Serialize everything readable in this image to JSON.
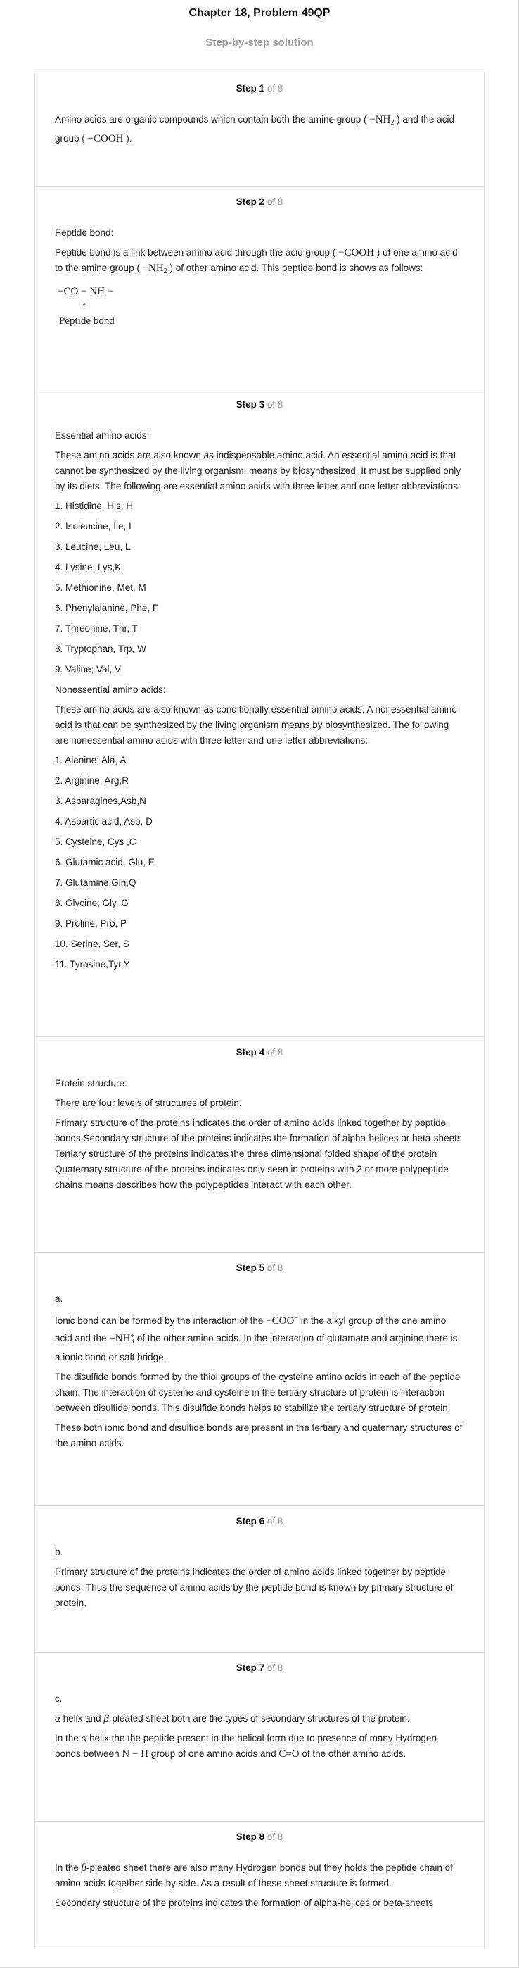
{
  "header": {
    "title": "Chapter 18, Problem 49QP",
    "subtitle": "Step-by-step solution"
  },
  "of_total": "of 8",
  "steps": [
    {
      "label": "Step 1",
      "p1_a": "Amino acids are organic compounds which contain both the amine group ( ",
      "p1_m1": "−NH",
      "p1_m1_sub": "2",
      "p1_b": " ) and the acid group ( ",
      "p1_m2": "−COOH",
      "p1_c": " )."
    },
    {
      "label": "Step 2",
      "heading": "Peptide bond:",
      "p1_a": "Peptide bond is a link between amino acid through the acid group ( ",
      "p1_m1": "−COOH",
      "p1_b": " ) of one amino acid to the amine group ( ",
      "p1_m2": "−NH",
      "p1_m2_sub": "2",
      "p1_c": " ) of other amino acid. This peptide bond is shows as follows:",
      "formula": "−CO − NH −",
      "arrow": "↑",
      "formula_label": "Peptide bond"
    },
    {
      "label": "Step 3",
      "heading1": "Essential amino acids:",
      "para1": "These amino acids are also known as indispensable amino acid. An essential amino acid is that cannot be synthesized by the living organism, means by biosynthesized. It must be supplied only by its diets. The following are essential amino acids with three letter and one letter abbreviations:",
      "essential": [
        "1. Histidine, His, H",
        "2. Isoleucine, Ile, I",
        "3. Leucine, Leu, L",
        "4. Lysine, Lys,K",
        "5. Methionine, Met, M",
        "6. Phenylalanine, Phe, F",
        "7. Threonine, Thr, T",
        "8. Tryptophan, Trp, W",
        "9. Valine; Val, V"
      ],
      "heading2": "Nonessential amino acids:",
      "para2": "These amino acids are also known as conditionally essential amino acids. A nonessential amino acid is that can be synthesized by the living organism means by biosynthesized. The following are nonessential amino acids with three letter and one letter abbreviations:",
      "nonessential": [
        "1. Alanine; Ala, A",
        "2. Arginine, Arg,R",
        "3. Asparagines,Asb,N",
        "4. Aspartic acid, Asp, D",
        "5. Cysteine, Cys ,C",
        "6. Glutamic acid, Glu, E",
        "7. Glutamine,Gln,Q",
        "8. Glycine; Gly, G",
        "9. Proline, Pro, P",
        "10. Serine, Ser, S",
        "11. Tyrosine,Tyr,Y"
      ]
    },
    {
      "label": "Step 4",
      "heading": "Protein structure:",
      "para1": "There are four levels of structures of protein.",
      "para2": "Primary structure of the proteins indicates the order of amino acids linked together by peptide bonds.Secondary structure of the proteins indicates the formation of alpha-helices or beta-sheets Tertiary structure of the proteins indicates the three dimensional folded shape of the protein Quaternary structure of the proteins indicates only seen in proteins with 2 or more polypeptide chains means describes how the polypeptides interact with each other."
    },
    {
      "label": "Step 5",
      "part": "a.",
      "p1_a": "Ionic bond can be formed by the interaction of the ",
      "p1_m1": "−COO",
      "p1_m1_sup": "−",
      "p1_b": " in the alkyl group of the one amino acid and the ",
      "p1_m2": "−NH",
      "p1_m2_sub": "3",
      "p1_m2_sup": "+",
      "p1_c": " of the other amino acids. In the interaction of glutamate and arginine there is a ionic bond or salt bridge.",
      "para2": "The disulfide bonds formed by the thiol groups of the cysteine amino acids in each of the peptide chain. The interaction of cysteine and cysteine in the tertiary structure of protein is interaction between disulfide bonds. This disulfide bonds helps to stabilize the tertiary structure of protein.",
      "para3": "These both ionic bond and disulfide bonds are present in the tertiary and quaternary structures of the amino acids."
    },
    {
      "label": "Step 6",
      "part": "b.",
      "para1": "Primary structure of the proteins indicates the order of amino acids linked together by peptide bonds. Thus the sequence of amino acids by the peptide bond is known by primary structure of protein."
    },
    {
      "label": "Step 7",
      "part": "c.",
      "p1_m1": "α",
      "p1_a": " helix and ",
      "p1_m2": "β",
      "p1_b": "-pleated sheet both are the types of secondary structures of the protein.",
      "p2_a": "In the ",
      "p2_m1": "α",
      "p2_b": " helix the the peptide present in the helical form due to presence of many Hydrogen bonds between ",
      "p2_m2": "N − H",
      "p2_c": " group of one amino acids and ",
      "p2_m3": "C=O",
      "p2_d": " of the other amino acids."
    },
    {
      "label": "Step 8",
      "p1_a": "In the ",
      "p1_m1": "β",
      "p1_b": "-pleated sheet there are also many Hydrogen bonds but they holds the peptide chain of amino acids together side by side. As a result of these sheet structure is formed.",
      "para2": "Secondary structure of the proteins indicates the formation of alpha-helices or beta-sheets"
    }
  ]
}
